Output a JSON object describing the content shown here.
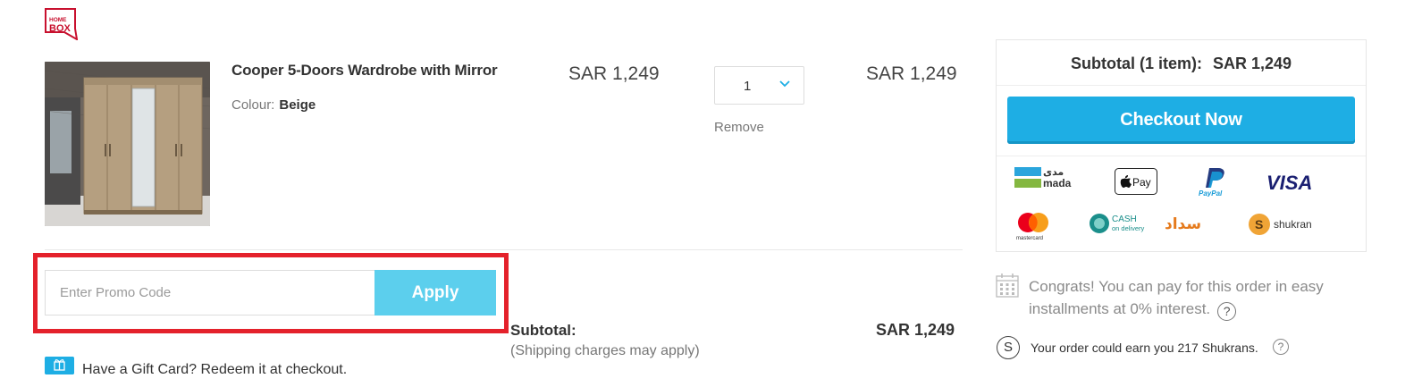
{
  "brand": {
    "logo_line1": "HOME",
    "logo_line2": "BOX"
  },
  "cart_item": {
    "name": "Cooper 5-Doors Wardrobe with Mirror",
    "colour_label": "Colour:",
    "colour_value": "Beige",
    "unit_price": "SAR 1,249",
    "quantity": "1",
    "remove_label": "Remove",
    "line_total": "SAR 1,249"
  },
  "promo": {
    "placeholder": "Enter Promo Code",
    "apply_label": "Apply"
  },
  "subtotal": {
    "label": "Subtotal:",
    "note": "(Shipping charges may apply)",
    "amount": "SAR 1,249"
  },
  "gift_card": {
    "text": "Have a Gift Card? Redeem it at checkout."
  },
  "summary": {
    "title": "Subtotal (1 item):",
    "amount": "SAR 1,249",
    "checkout_label": "Checkout Now",
    "payment_methods": [
      {
        "name": "mada",
        "label_ar": "مدى",
        "label_en": "mada"
      },
      {
        "name": "apple-pay",
        "label": "Pay"
      },
      {
        "name": "paypal",
        "label": "PayPal"
      },
      {
        "name": "visa",
        "label": "VISA"
      },
      {
        "name": "mastercard",
        "label": "mastercard"
      },
      {
        "name": "cash-on-delivery",
        "label_top": "CASH",
        "label_bottom": "on delivery"
      },
      {
        "name": "sadad",
        "label": "سداد"
      },
      {
        "name": "shukran",
        "label": "shukran"
      }
    ]
  },
  "installments": {
    "text": "Congrats! You can pay for this order in easy installments at 0% interest.",
    "help": "?"
  },
  "shukran_earn": {
    "icon_letter": "S",
    "text": "Your order could earn you 217 Shukrans.",
    "help": "?"
  },
  "colors": {
    "primary_blue": "#1eaee4",
    "apply_blue": "#5ccfed",
    "highlight_red": "#e4212b",
    "brand_red": "#c8102e"
  }
}
